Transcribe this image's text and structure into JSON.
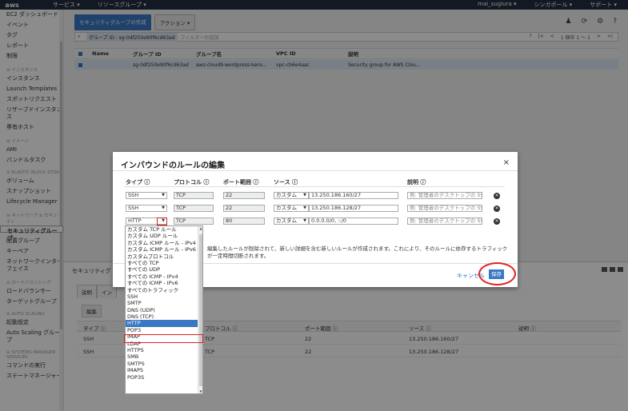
{
  "topnav": {
    "logo": "aws",
    "menu": [
      "サービス ▾",
      "リソースグループ ▾"
    ],
    "right": [
      "mai_sugiura ▾",
      "シンガポール ▾",
      "サポート ▾"
    ]
  },
  "sidebar": {
    "items": [
      {
        "type": "item",
        "label": "EC2 ダッシュボード"
      },
      {
        "type": "item",
        "label": "イベント"
      },
      {
        "type": "item",
        "label": "タグ"
      },
      {
        "type": "item",
        "label": "レポート"
      },
      {
        "type": "item",
        "label": "制限"
      },
      {
        "type": "sect",
        "label": "⊖ インスタンス"
      },
      {
        "type": "item",
        "label": "インスタンス"
      },
      {
        "type": "item",
        "label": "Launch Templates"
      },
      {
        "type": "item",
        "label": "スポットリクエスト"
      },
      {
        "type": "item",
        "label": "リザーブドインスタンス"
      },
      {
        "type": "item",
        "label": "専有ホスト"
      },
      {
        "type": "sect",
        "label": "⊖ イメージ"
      },
      {
        "type": "item",
        "label": "AMI"
      },
      {
        "type": "item",
        "label": "バンドルタスク"
      },
      {
        "type": "sect",
        "label": "⊖ ELASTIC BLOCK STORE"
      },
      {
        "type": "item",
        "label": "ボリューム"
      },
      {
        "type": "item",
        "label": "スナップショット"
      },
      {
        "type": "item",
        "label": "Lifecycle Manager"
      },
      {
        "type": "sect",
        "label": "⊖ ネットワーク & セキュリティ"
      },
      {
        "type": "item",
        "label": "セキュリティグループ",
        "selected": true
      },
      {
        "type": "item",
        "label": "Elastic IP"
      },
      {
        "type": "item",
        "label": "配置グループ"
      },
      {
        "type": "item",
        "label": "キーペア"
      },
      {
        "type": "item",
        "label": "ネットワークインターフェイス"
      },
      {
        "type": "sect",
        "label": "⊖ ロードバランシング"
      },
      {
        "type": "item",
        "label": "ロードバランサー"
      },
      {
        "type": "item",
        "label": "ターゲットグループ"
      },
      {
        "type": "sect",
        "label": "⊖ AUTO SCALING"
      },
      {
        "type": "item",
        "label": "起動設定"
      },
      {
        "type": "item",
        "label": "Auto Scaling グループ"
      },
      {
        "type": "sect",
        "label": "⊖ SYSTEMS MANAGER SERVICES"
      },
      {
        "type": "item",
        "label": "コマンドの実行"
      },
      {
        "type": "item",
        "label": "ステートマネージャー"
      }
    ]
  },
  "toolbar": {
    "create_label": "セキュリティグループの作成",
    "actions_label": "アクション ▾"
  },
  "filter": {
    "chip": "グループ ID : sg-0df250e90f6cd63ad",
    "placeholder": "フィルターの追加",
    "pager": "1 個中 1 ～ 1"
  },
  "table": {
    "headers": [
      "Name",
      "グループ ID",
      "グループ名",
      "VPC ID",
      "説明"
    ],
    "row": [
      "",
      "sg-0df250e90f6cd63ad",
      "aws-cloud9-wordpress-kens...",
      "vpc-cb6e4aac",
      "Security group for AWS Clou..."
    ]
  },
  "lower": {
    "title": "セキュリティグ",
    "tabs": [
      "説明",
      "イン"
    ],
    "edit_label": "編集",
    "headers": [
      "タイプ ⓘ",
      "プロトコル ⓘ",
      "ポート範囲 ⓘ",
      "ソース ⓘ",
      "説明 ⓘ"
    ],
    "rows": [
      [
        "SSH",
        "TCP",
        "22",
        "13.250.186.160/27",
        ""
      ],
      [
        "SSH",
        "TCP",
        "22",
        "13.250.186.128/27",
        ""
      ]
    ]
  },
  "modal": {
    "title": "インバウンドのルールの編集",
    "close": "×",
    "headers": [
      "タイプ ⓘ",
      "プロトコル ⓘ",
      "ポート範囲 ⓘ",
      "ソース ⓘ",
      "説明 ⓘ"
    ],
    "rows": [
      {
        "type": "SSH",
        "protocol": "TCP",
        "port": "22",
        "source_sel": "カスタム",
        "source": "13.250.186.160/27",
        "desc_ph": "例: 管理者のデスクトップの SS"
      },
      {
        "type": "SSH",
        "protocol": "TCP",
        "port": "22",
        "source_sel": "カスタム",
        "source": "13.250.186.128/27",
        "desc_ph": "例: 管理者のデスクトップの SS"
      },
      {
        "type": "HTTP",
        "protocol": "TCP",
        "port": "80",
        "source_sel": "カスタム",
        "source": "0.0.0.0/0, ::/0",
        "desc_ph": "例: 管理者のデスクトップの SS"
      }
    ],
    "note": "編集したルールが削除されて、新しい詳細を含む新しいルールが作成されます。これにより、そのルールに依存するトラフィックが一定時間切断されます。",
    "cancel": "キャンセル",
    "save": "保存"
  },
  "dropdown": {
    "options": [
      "カスタム TCP ルール",
      "カスタム UDP ルール",
      "カスタム ICMP ルール - IPv4",
      "カスタム ICMP ルール - IPv6",
      "カスタムプロトコル",
      "すべての TCP",
      "すべての UDP",
      "すべての ICMP - IPv4",
      "すべての ICMP - IPv6",
      "すべてのトラフィック",
      "SSH",
      "SMTP",
      "DNS (UDP)",
      "DNS (TCP)",
      "HTTP",
      "POP3",
      "IMAP",
      "LDAP",
      "HTTPS",
      "SMB",
      "SMTPS",
      "IMAPS",
      "POP3S"
    ],
    "selected_index": 14
  }
}
